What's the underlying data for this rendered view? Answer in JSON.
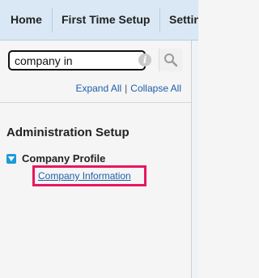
{
  "topnav": {
    "tabs": [
      {
        "label": "Home"
      },
      {
        "label": "First Time Setup"
      },
      {
        "label": "Settin"
      }
    ]
  },
  "search": {
    "value": "company in",
    "placeholder": ""
  },
  "tree_controls": {
    "expand_all": "Expand All",
    "separator": "|",
    "collapse_all": "Collapse All"
  },
  "section": {
    "title": "Administration Setup",
    "node": {
      "label": "Company Profile",
      "expanded": true,
      "children": [
        {
          "label": "Company Information",
          "highlighted": true
        }
      ]
    }
  },
  "colors": {
    "nav_bg": "#d9e8f4",
    "link": "#1f5fa8",
    "toggle": "#1a9bd7",
    "highlight": "#e8175d"
  },
  "icons": {
    "info": "info-icon",
    "search": "search-icon",
    "toggle": "collapse-toggle-icon"
  }
}
